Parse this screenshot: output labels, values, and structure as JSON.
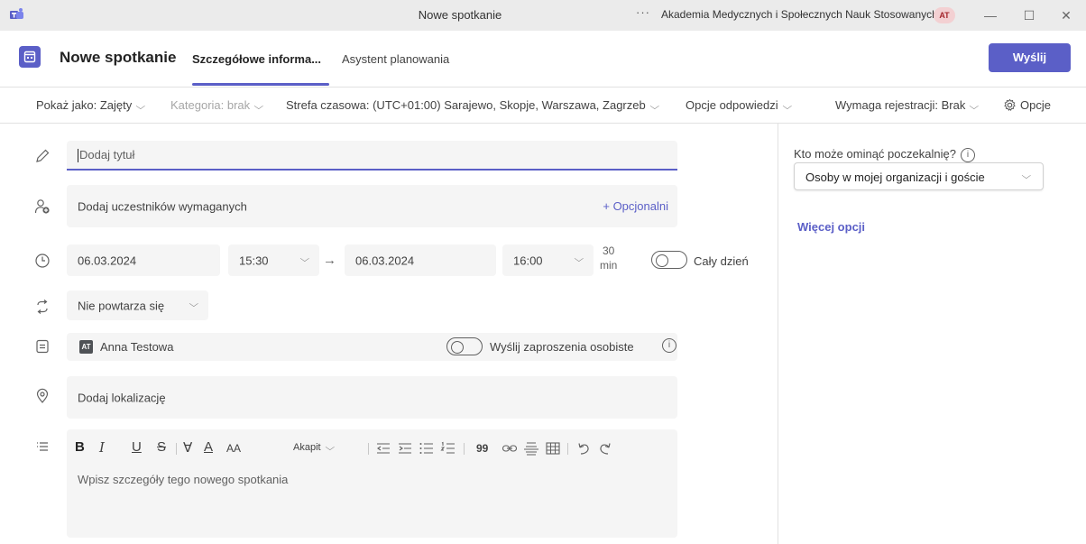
{
  "window": {
    "title": "Nowe spotkanie",
    "more": "···",
    "org": "Akademia Medycznych i Społecznych Nauk Stosowanych",
    "org_avatar": "AT",
    "minimize": "—",
    "maximize": "☐",
    "close": "✕"
  },
  "header": {
    "title": "Nowe spotkanie",
    "tabs": [
      {
        "label": "Szczegółowe informa..."
      },
      {
        "label": "Asystent planowania"
      }
    ],
    "send_label": "Wyślij"
  },
  "options": {
    "show_as": "Pokaż jako: Zajęty",
    "category": "Kategoria: brak",
    "timezone": "Strefa czasowa: (UTC+01:00) Sarajewo, Skopje, Warszawa, Zagrzeb",
    "response_options": "Opcje odpowiedzi",
    "registration": "Wymaga rejestracji: Brak",
    "options_label": "Opcje"
  },
  "form": {
    "title_placeholder": "Dodaj tytuł",
    "attendees_placeholder": "Dodaj uczestników wymaganych",
    "optional_link": "+ Opcjonalni",
    "start_date": "06.03.2024",
    "start_time": "15:30",
    "arrow": "→",
    "end_date": "06.03.2024",
    "end_time": "16:00",
    "duration_value": "30",
    "duration_unit": "min",
    "all_day_label": "Cały dzień",
    "repeat": "Nie powtarza się",
    "calendar_avatar": "AT",
    "calendar_owner": "Anna Testowa",
    "personal_invites_label": "Wyślij zaproszenia osobiste",
    "location_placeholder": "Dodaj lokalizację",
    "details_placeholder": "Wpisz szczegóły tego nowego spotkania"
  },
  "editor_toolbar": {
    "bold": "B",
    "italic": "I",
    "underline": "U",
    "strikethrough": "S",
    "highlight": "∀",
    "font_color": "A",
    "font_size": "AA",
    "paragraph": "Akapit",
    "quote": "99"
  },
  "sidebar": {
    "lobby_label": "Kto może ominąć poczekalnię?",
    "lobby_value": "Osoby w mojej organizacji i goście",
    "more_options": "Więcej opcji"
  },
  "colors": {
    "accent": "#5b5fc7",
    "field_bg": "#f5f5f5",
    "titlebar_bg": "#ebebeb"
  }
}
